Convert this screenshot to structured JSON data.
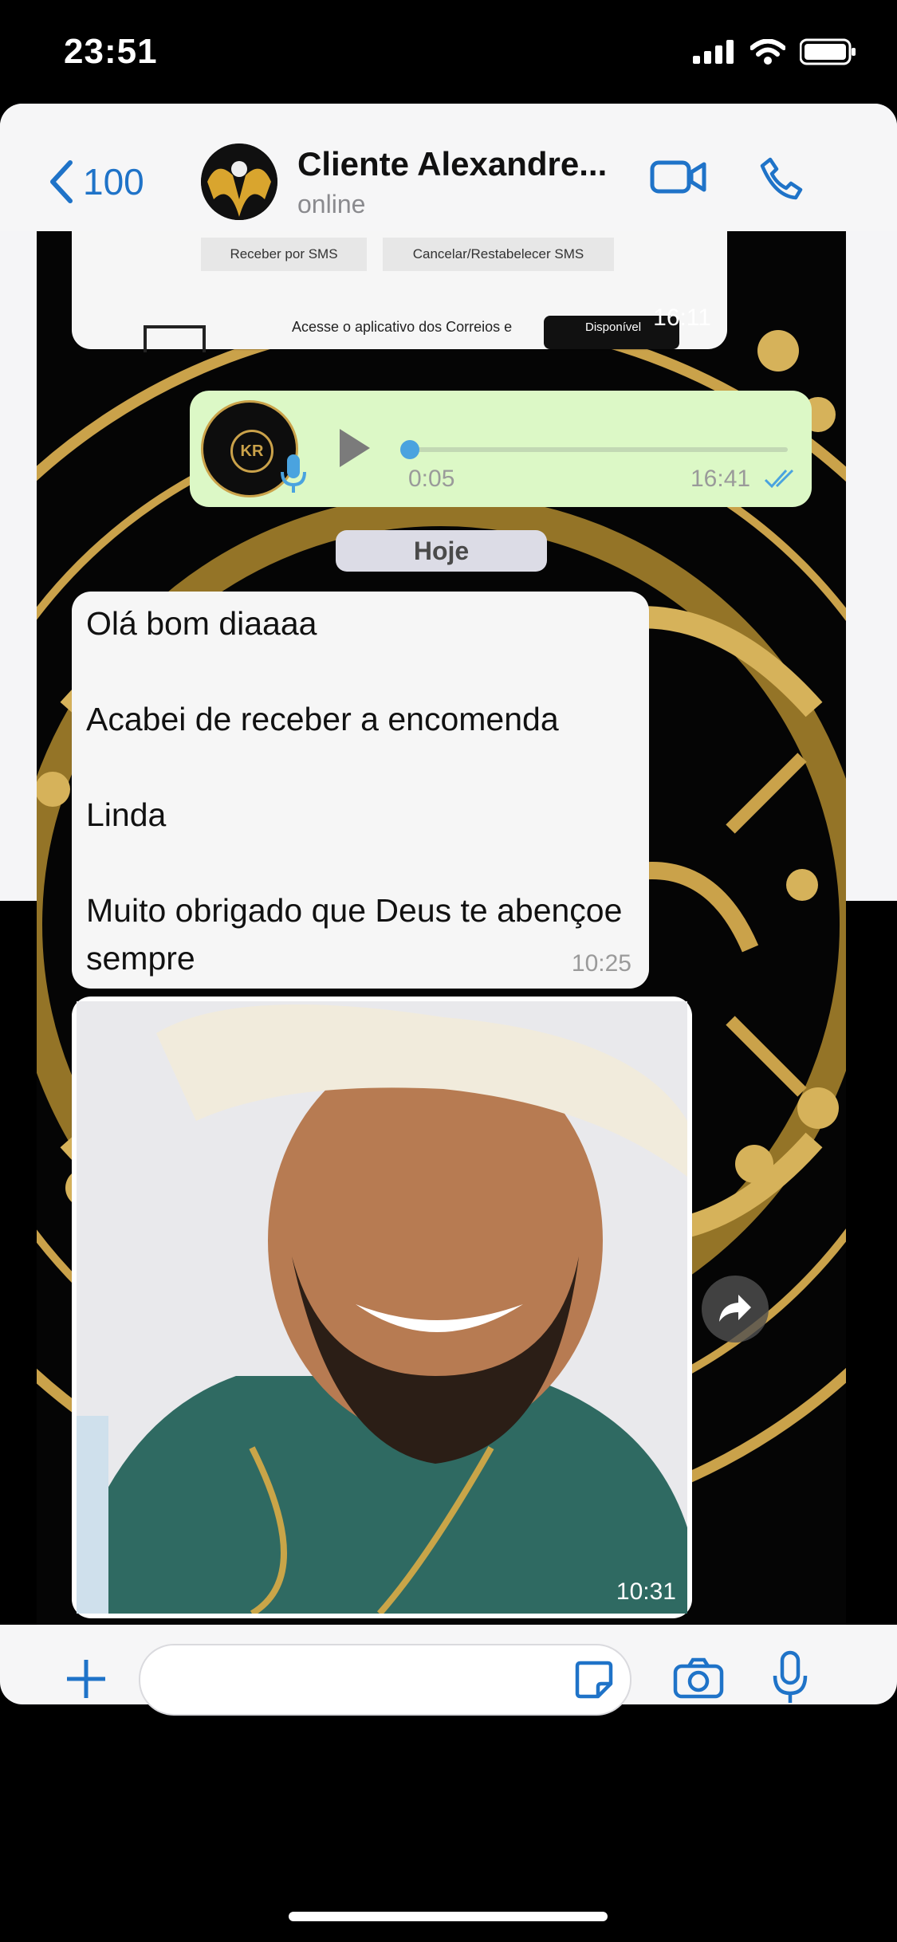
{
  "status": {
    "time": "23:51"
  },
  "nav": {
    "back_count": "100",
    "contact_name": "Cliente Alexandre...",
    "presence": "online"
  },
  "messages": {
    "image_top": {
      "button_sms": "Receber por SMS",
      "button_cancel": "Cancelar/Restabelecer SMS",
      "footer_text": "Acesse o aplicativo dos Correios e",
      "badge": "Disponível",
      "time": "16:11"
    },
    "voice": {
      "duration": "0:05",
      "time": "16:41",
      "avatar_text": "KR"
    },
    "date_separator": "Hoje",
    "text_in": {
      "text": "Olá bom diaaaa\n\nAcabei de receber a encomenda\n\nLinda\n\nMuito obrigado que Deus te abençoe sempre",
      "time": "10:25"
    },
    "photo": {
      "time": "10:31"
    }
  },
  "colors": {
    "accent": "#1f73c8",
    "outgoing": "#dcf8c6",
    "incoming": "#f6f6f6",
    "gold": "#caa24a"
  },
  "icons": [
    "chevron-left-icon",
    "video-call-icon",
    "phone-icon",
    "mic-icon",
    "play-icon",
    "double-check-icon",
    "forward-icon",
    "plus-icon",
    "sticker-icon",
    "camera-icon",
    "microphone-icon"
  ]
}
